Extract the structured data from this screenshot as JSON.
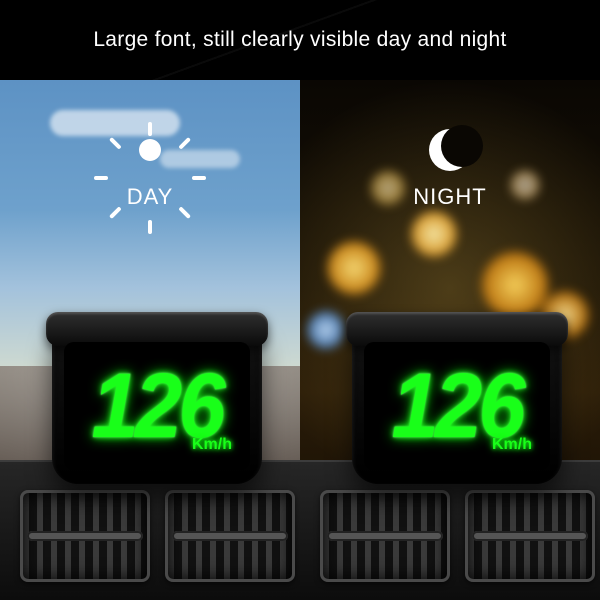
{
  "headline": "Large font, still clearly visible day and night",
  "panels": {
    "day": {
      "condition_label": "DAY",
      "speed": "126",
      "unit": "Km/h"
    },
    "night": {
      "condition_label": "NIGHT",
      "speed": "126",
      "unit": "Km/h"
    }
  },
  "colors": {
    "digit_green": "#19ff19",
    "background": "#000000"
  },
  "icons": {
    "day": "sun-icon",
    "night": "moon-icon"
  }
}
